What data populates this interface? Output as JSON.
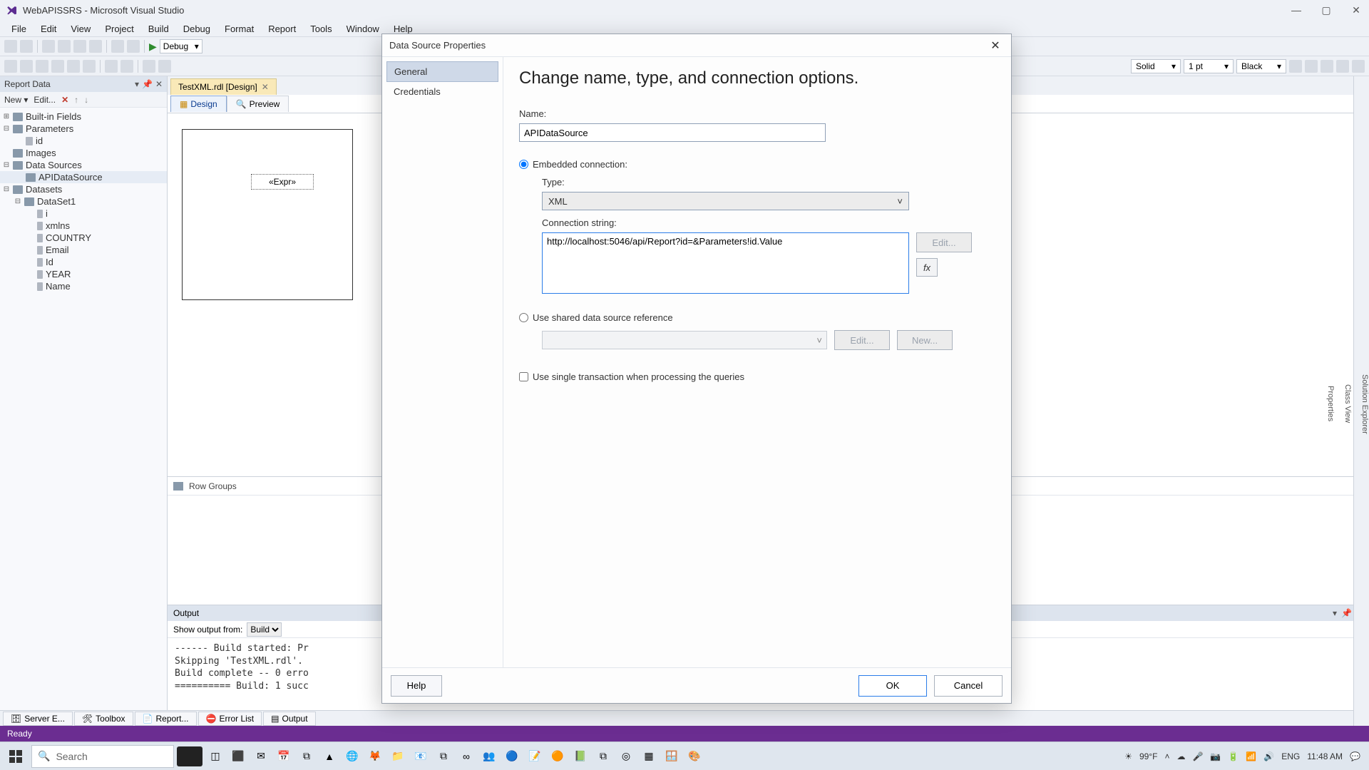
{
  "title": "WebAPISSRS - Microsoft Visual Studio",
  "menus": [
    "File",
    "Edit",
    "View",
    "Project",
    "Build",
    "Debug",
    "Format",
    "Report",
    "Tools",
    "Window",
    "Help"
  ],
  "debug_config": "Debug",
  "style_combos": {
    "border_style": "Solid",
    "border_width": "1 pt",
    "border_color": "Black"
  },
  "reportdata": {
    "title": "Report Data",
    "toolbar": [
      "New  ▾",
      "Edit..."
    ],
    "tree": {
      "builtin": "Built-in Fields",
      "parameters": "Parameters",
      "param_id": "id",
      "images": "Images",
      "datasources": "Data Sources",
      "apids": "APIDataSource",
      "datasets": "Datasets",
      "dataset1": "DataSet1",
      "fields": [
        "i",
        "xmlns",
        "COUNTRY",
        "Email",
        "Id",
        "YEAR",
        "Name"
      ]
    }
  },
  "doc": {
    "tab": "TestXML.rdl [Design]",
    "design": "Design",
    "preview": "Preview",
    "expr": "«Expr»",
    "rowgroups": "Row Groups"
  },
  "output": {
    "title": "Output",
    "show_from_label": "Show output from:",
    "show_from": "Build",
    "text": "------ Build started: Pr\nSkipping 'TestXML.rdl'.\nBuild complete -- 0 erro\n========== Build: 1 succ"
  },
  "bottom_tabs": [
    "Server E...",
    "Toolbox",
    "Report...",
    "Error List",
    "Output"
  ],
  "right_rail": [
    "Solution Explorer",
    "Class View",
    "Properties"
  ],
  "status": "Ready",
  "dialog": {
    "title": "Data Source Properties",
    "side": [
      "General",
      "Credentials"
    ],
    "heading": "Change name, type, and connection options.",
    "name_label": "Name:",
    "name_value": "APIDataSource",
    "embedded_label": "Embedded connection:",
    "type_label": "Type:",
    "type_value": "XML",
    "conn_label": "Connection string:",
    "conn_value": "http://localhost:5046/api/Report?id=&Parameters!id.Value",
    "edit": "Edit...",
    "fx": "fx",
    "shared_label": "Use shared data source reference",
    "shared_edit": "Edit...",
    "shared_new": "New...",
    "single_tx": "Use single transaction when processing the queries",
    "help": "Help",
    "ok": "OK",
    "cancel": "Cancel"
  },
  "taskbar": {
    "search_placeholder": "Search",
    "temp": "99°F",
    "lang": "ENG",
    "time": "11:48 AM"
  }
}
